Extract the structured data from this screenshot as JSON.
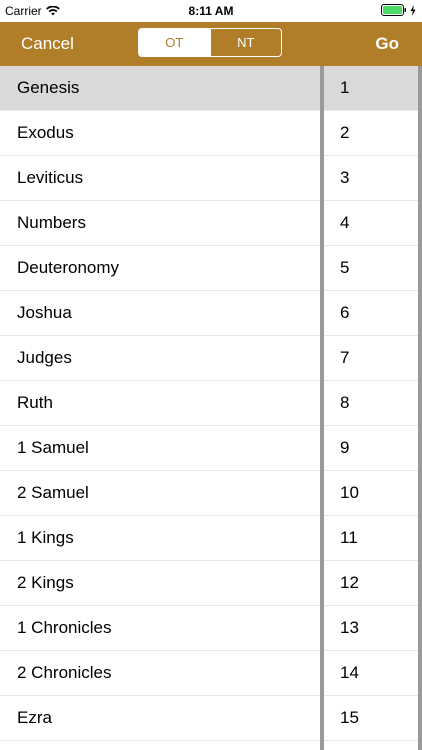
{
  "status_bar": {
    "carrier": "Carrier",
    "time": "8:11 AM",
    "icons": [
      "wifi-icon",
      "battery-icon",
      "charging-bolt-icon"
    ]
  },
  "nav": {
    "cancel_label": "Cancel",
    "go_label": "Go",
    "segments": [
      {
        "label": "OT",
        "selected": true
      },
      {
        "label": "NT",
        "selected": false
      }
    ],
    "bar_color": "#b07d28"
  },
  "books": [
    {
      "label": "Genesis",
      "selected": true
    },
    {
      "label": "Exodus",
      "selected": false
    },
    {
      "label": "Leviticus",
      "selected": false
    },
    {
      "label": "Numbers",
      "selected": false
    },
    {
      "label": "Deuteronomy",
      "selected": false
    },
    {
      "label": "Joshua",
      "selected": false
    },
    {
      "label": "Judges",
      "selected": false
    },
    {
      "label": "Ruth",
      "selected": false
    },
    {
      "label": "1 Samuel",
      "selected": false
    },
    {
      "label": "2 Samuel",
      "selected": false
    },
    {
      "label": "1 Kings",
      "selected": false
    },
    {
      "label": "2 Kings",
      "selected": false
    },
    {
      "label": "1 Chronicles",
      "selected": false
    },
    {
      "label": "2 Chronicles",
      "selected": false
    },
    {
      "label": "Ezra",
      "selected": false
    }
  ],
  "chapters": [
    {
      "label": "1",
      "selected": true
    },
    {
      "label": "2",
      "selected": false
    },
    {
      "label": "3",
      "selected": false
    },
    {
      "label": "4",
      "selected": false
    },
    {
      "label": "5",
      "selected": false
    },
    {
      "label": "6",
      "selected": false
    },
    {
      "label": "7",
      "selected": false
    },
    {
      "label": "8",
      "selected": false
    },
    {
      "label": "9",
      "selected": false
    },
    {
      "label": "10",
      "selected": false
    },
    {
      "label": "11",
      "selected": false
    },
    {
      "label": "12",
      "selected": false
    },
    {
      "label": "13",
      "selected": false
    },
    {
      "label": "14",
      "selected": false
    },
    {
      "label": "15",
      "selected": false
    }
  ]
}
